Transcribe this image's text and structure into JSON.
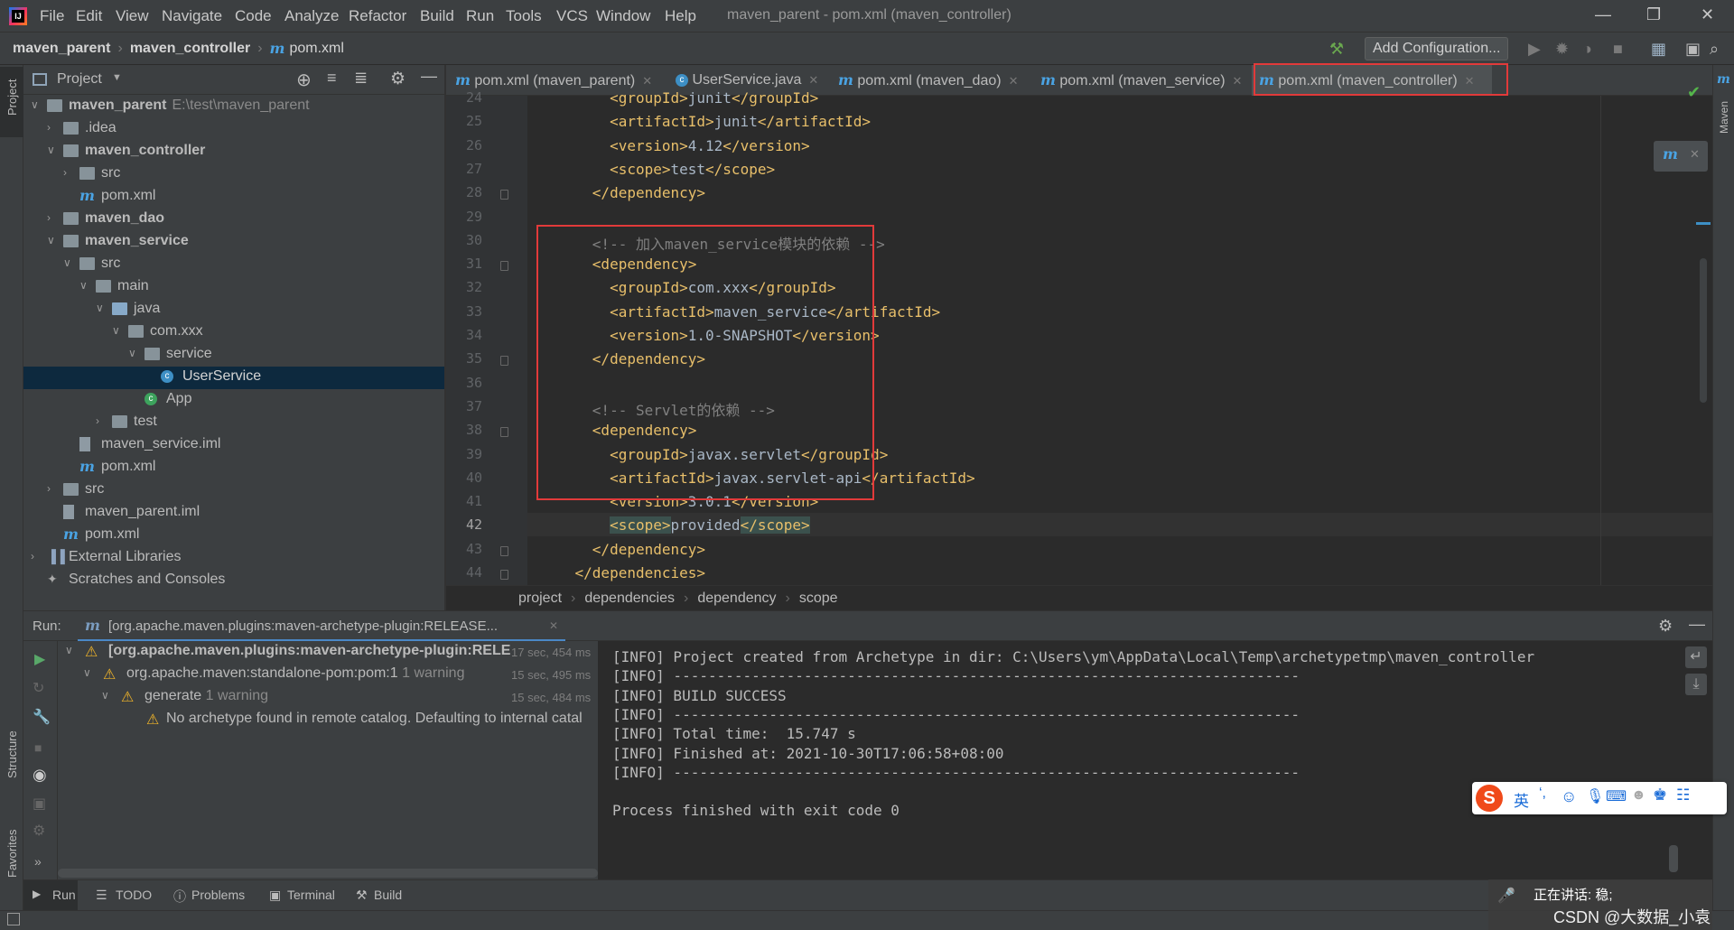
{
  "menubar": {
    "items": [
      "File",
      "Edit",
      "View",
      "Navigate",
      "Code",
      "Analyze",
      "Refactor",
      "Build",
      "Run",
      "Tools",
      "VCS",
      "Window",
      "Help"
    ],
    "title": "maven_parent - pom.xml (maven_controller)"
  },
  "navbar": {
    "crumbs": [
      "maven_parent",
      "maven_controller",
      "pom.xml"
    ],
    "add_config": "Add Configuration..."
  },
  "left_strip": {
    "project": "Project",
    "structure": "Structure",
    "favorites": "Favorites"
  },
  "right_strip": {
    "maven": "Maven"
  },
  "project_panel": {
    "title": "Project",
    "tree": [
      {
        "label": "maven_parent",
        "path": "E:\\test\\maven_parent"
      },
      {
        "label": ".idea"
      },
      {
        "label": "maven_controller"
      },
      {
        "label": "src"
      },
      {
        "label": "pom.xml"
      },
      {
        "label": "maven_dao"
      },
      {
        "label": "maven_service"
      },
      {
        "label": "src"
      },
      {
        "label": "main"
      },
      {
        "label": "java"
      },
      {
        "label": "com.xxx"
      },
      {
        "label": "service"
      },
      {
        "label": "UserService"
      },
      {
        "label": "App"
      },
      {
        "label": "test"
      },
      {
        "label": "maven_service.iml"
      },
      {
        "label": "pom.xml"
      },
      {
        "label": "src"
      },
      {
        "label": "maven_parent.iml"
      },
      {
        "label": "pom.xml"
      },
      {
        "label": "External Libraries"
      },
      {
        "label": "Scratches and Consoles"
      }
    ]
  },
  "tabs": [
    {
      "label": "pom.xml (maven_parent)"
    },
    {
      "label": "UserService.java"
    },
    {
      "label": "pom.xml (maven_dao)"
    },
    {
      "label": "pom.xml (maven_service)"
    },
    {
      "label": "pom.xml (maven_controller)",
      "active": true
    }
  ],
  "editor": {
    "lines": [
      {
        "n": "24",
        "code": "        <groupId>junit</groupId>"
      },
      {
        "n": "25",
        "code": "        <artifactId>junit</artifactId>"
      },
      {
        "n": "26",
        "code": "        <version>4.12</version>"
      },
      {
        "n": "27",
        "code": "        <scope>test</scope>"
      },
      {
        "n": "28",
        "code": "      </dependency>"
      },
      {
        "n": "29",
        "code": ""
      },
      {
        "n": "30",
        "code": "      <!-- 加入maven_service模块的依赖 -->"
      },
      {
        "n": "31",
        "code": "      <dependency>"
      },
      {
        "n": "32",
        "code": "        <groupId>com.xxx</groupId>"
      },
      {
        "n": "33",
        "code": "        <artifactId>maven_service</artifactId>"
      },
      {
        "n": "34",
        "code": "        <version>1.0-SNAPSHOT</version>"
      },
      {
        "n": "35",
        "code": "      </dependency>"
      },
      {
        "n": "36",
        "code": ""
      },
      {
        "n": "37",
        "code": "      <!-- Servlet的依赖 -->"
      },
      {
        "n": "38",
        "code": "      <dependency>"
      },
      {
        "n": "39",
        "code": "        <groupId>javax.servlet</groupId>"
      },
      {
        "n": "40",
        "code": "        <artifactId>javax.servlet-api</artifactId>"
      },
      {
        "n": "41",
        "code": "        <version>3.0.1</version>"
      },
      {
        "n": "42",
        "code": "        <scope>provided</scope>"
      },
      {
        "n": "43",
        "code": "      </dependency>"
      },
      {
        "n": "44",
        "code": "    </dependencies>"
      }
    ],
    "breadcrumb": [
      "project",
      "dependencies",
      "dependency",
      "scope"
    ]
  },
  "run": {
    "label": "Run:",
    "tab": "[org.apache.maven.plugins:maven-archetype-plugin:RELEASE...",
    "tree": [
      {
        "text": "[org.apache.maven.plugins:maven-archetype-plugin:RELE",
        "time": "17 sec, 454 ms"
      },
      {
        "text": "org.apache.maven:standalone-pom:pom:1",
        "note": "1 warning",
        "time": "15 sec, 495 ms"
      },
      {
        "text": "generate",
        "note": "1 warning",
        "time": "15 sec, 484 ms"
      },
      {
        "text": "No archetype found in remote catalog. Defaulting to internal catal"
      }
    ],
    "console": [
      "[INFO] Project created from Archetype in dir: C:\\Users\\ym\\AppData\\Local\\Temp\\archetypetmp\\maven_controller",
      "[INFO] ------------------------------------------------------------------------",
      "[INFO] BUILD SUCCESS",
      "[INFO] ------------------------------------------------------------------------",
      "[INFO] Total time:  15.747 s",
      "[INFO] Finished at: 2021-10-30T17:06:58+08:00",
      "[INFO] ------------------------------------------------------------------------",
      "",
      "Process finished with exit code 0"
    ]
  },
  "bottom_tabs": [
    "Run",
    "TODO",
    "Problems",
    "Terminal",
    "Build"
  ],
  "ime": {
    "lang": "英"
  },
  "overlay": {
    "speaking": "正在讲话: 稳;",
    "watermark": "CSDN @大数据_小袁"
  },
  "colors": {
    "tag": "#e8bf6a",
    "comment": "#808080",
    "highlight_box": "#e23a3a",
    "selection": "#0d293e"
  }
}
